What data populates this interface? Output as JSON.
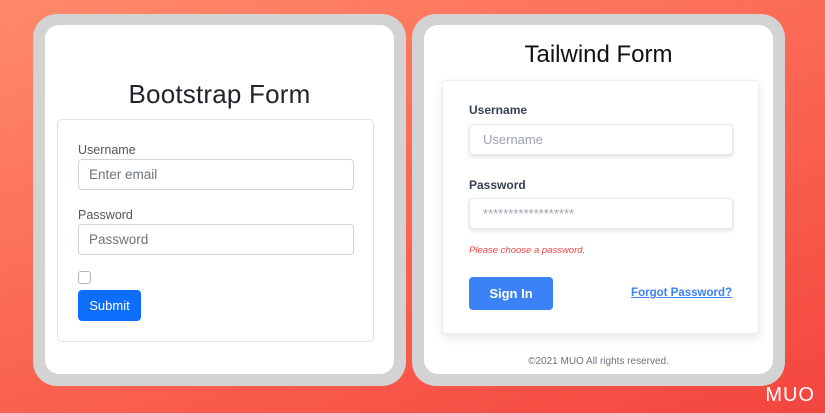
{
  "bootstrap": {
    "title": "Bootstrap Form",
    "username_label": "Username",
    "username_placeholder": "Enter email",
    "password_label": "Password",
    "password_placeholder": "Password",
    "submit_label": "Submit",
    "accent_color": "#0d6efd"
  },
  "tailwind": {
    "title": "Tailwind Form",
    "username_label": "Username",
    "username_placeholder": "Username",
    "password_label": "Password",
    "password_placeholder": "******************",
    "error_text": "Please choose a password.",
    "signin_label": "Sign In",
    "forgot_label": "Forgot Password?",
    "footer": "©2021 MUO All rights reserved.",
    "accent_color": "#3b82f6",
    "error_color": "#ef4444"
  },
  "watermark": "MUO"
}
